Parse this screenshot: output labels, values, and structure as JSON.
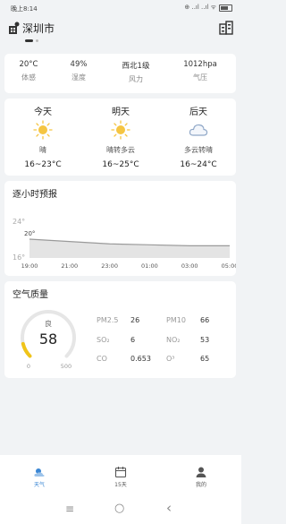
{
  "status": {
    "time": "晚上8:14",
    "signal_text": "⊕ ..ıl ..ıl ᯤ"
  },
  "header": {
    "city": "深圳市"
  },
  "current": [
    {
      "value": "20°C",
      "label": "体感"
    },
    {
      "value": "49%",
      "label": "湿度"
    },
    {
      "value": "西北1级",
      "label": "风力"
    },
    {
      "value": "1012hpa",
      "label": "气压"
    }
  ],
  "forecast": [
    {
      "day": "今天",
      "condition": "晴",
      "temp": "16~23°C",
      "icon": "sun-icon"
    },
    {
      "day": "明天",
      "condition": "晴转多云",
      "temp": "16~25°C",
      "icon": "sun-icon"
    },
    {
      "day": "后天",
      "condition": "多云转晴",
      "temp": "16~24°C",
      "icon": "cloud-icon"
    }
  ],
  "hourly": {
    "title": "逐小时预报",
    "max_label": "24°",
    "min_label": "16°",
    "point_label": "20°",
    "chart_data": {
      "type": "area",
      "title": "逐小时预报",
      "x": [
        "19:00",
        "21:00",
        "23:00",
        "01:00",
        "03:00",
        "05:00"
      ],
      "y": [
        20,
        19.5,
        19,
        18.8,
        18.6,
        18.6
      ],
      "ylim": [
        16,
        24
      ],
      "colors": {
        "line": "#9a9a9a",
        "fill": "#e4e4e4"
      },
      "grid": false
    }
  },
  "air": {
    "title": "空气质量",
    "level": "良",
    "aqi": "58",
    "aqi_fraction": 0.116,
    "scale_min": "0",
    "scale_max": "500",
    "items": [
      {
        "label": "PM2.5",
        "value": "26"
      },
      {
        "label": "PM10",
        "value": "66"
      },
      {
        "label": "SO₂",
        "value": "6"
      },
      {
        "label": "NO₂",
        "value": "53"
      },
      {
        "label": "CO",
        "value": "0.653"
      },
      {
        "label": "O³",
        "value": "65"
      }
    ]
  },
  "nav": [
    {
      "label": "天气",
      "active": true
    },
    {
      "label": "15天",
      "active": false
    },
    {
      "label": "我的",
      "active": false
    }
  ],
  "system_nav": {
    "menu": "≡",
    "home": "○",
    "back": "‹"
  },
  "colors": {
    "accent": "#3a86d4",
    "sun": "#f5c542",
    "gauge": "#f0c419",
    "gauge_track": "#e6e6e6"
  }
}
